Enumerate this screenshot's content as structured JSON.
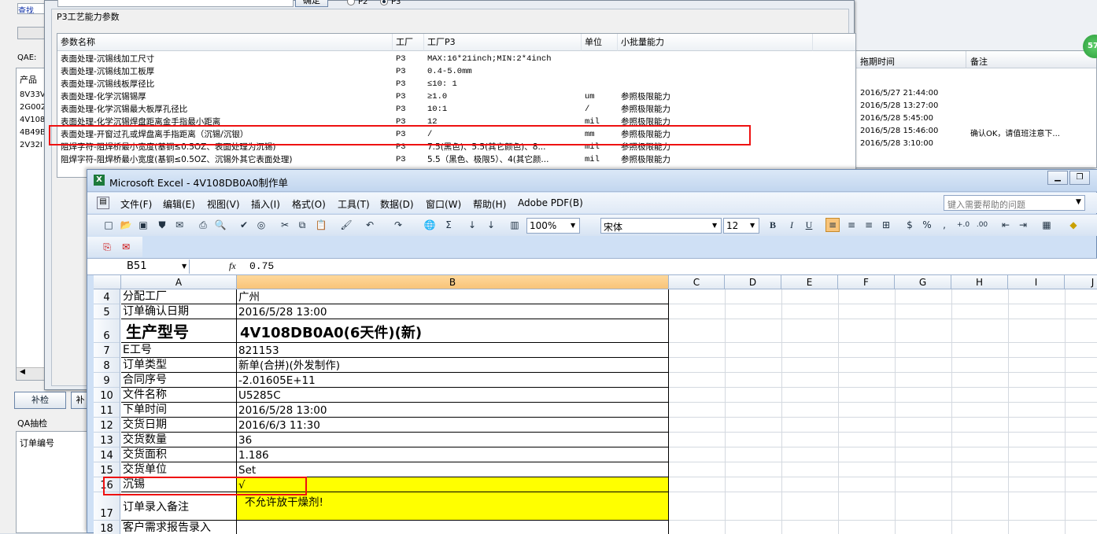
{
  "background": {
    "left_top_text": "查找",
    "qae_label": "QAE:",
    "product_col": "产品",
    "left_rows": [
      "8V33V",
      "2G002",
      "4V108",
      "4B49B",
      "2V32I"
    ],
    "btn_supplement": "补检",
    "btn_supplement2": "补",
    "qa_sample_label": "QA抽检",
    "order_no_col": "订单编号",
    "right_headers": [
      "拖期时间",
      "备注"
    ],
    "right_rows": [
      {
        "time": "2016/5/27 21:44:00",
        "note": ""
      },
      {
        "time": "2016/5/28 13:27:00",
        "note": ""
      },
      {
        "time": "2016/5/28 5:45:00",
        "note": ""
      },
      {
        "time": "2016/5/28 15:46:00",
        "note": "确认OK，请值班注意下..."
      },
      {
        "time": "2016/5/28 3:10:00",
        "note": ""
      }
    ],
    "badge": "57"
  },
  "dialog": {
    "confirm_btn": "确定",
    "radio_p2": "P2",
    "radio_p3": "P3",
    "group_title": "P3工艺能力参数",
    "columns": [
      "参数名称",
      "工厂",
      "工厂P3",
      "单位",
      "小批量能力"
    ],
    "rows": [
      [
        "表面处理-沉锡线加工尺寸",
        "P3",
        "MAX:16*21inch;MIN:2*4inch",
        "",
        ""
      ],
      [
        "表面处理-沉锡线加工板厚",
        "P3",
        "0.4-5.0mm",
        "",
        ""
      ],
      [
        "表面处理-沉锡线板厚径比",
        "P3",
        "≤10: 1",
        "",
        ""
      ],
      [
        "表面处理-化学沉锡锡厚",
        "P3",
        "≥1.0",
        "um",
        "参照极限能力"
      ],
      [
        "表面处理-化学沉锡最大板厚孔径比",
        "P3",
        "10:1",
        "/",
        "参照极限能力"
      ],
      [
        "表面处理-化学沉锡焊盘距离金手指最小距离",
        "P3",
        "12",
        "mil",
        "参照极限能力"
      ],
      [
        "表面处理-开窗过孔或焊盘离手指距离（沉锡/沉银）",
        "P3",
        "/",
        "mm",
        "参照极限能力"
      ],
      [
        "阻焊字符-阻焊桥最小宽度(基铜≤0.5OZ、表面处理为沉锡)",
        "P3",
        "7.5(黑色)、5.5(其它颜色)、8...",
        "mil",
        "参照极限能力"
      ],
      [
        "阻焊字符-阻焊桥最小宽度(基铜≤0.5OZ、沉锡外其它表面处理)",
        "P3",
        "5.5（黑色、极限5）、4(其它颜...",
        "mil",
        "参照极限能力"
      ]
    ]
  },
  "excel": {
    "title": "Microsoft Excel - 4V108DB0A0制作单",
    "menu": [
      "文件(F)",
      "编辑(E)",
      "视图(V)",
      "插入(I)",
      "格式(O)",
      "工具(T)",
      "数据(D)",
      "窗口(W)",
      "帮助(H)",
      "Adobe PDF(B)"
    ],
    "help_placeholder": "键入需要帮助的问题",
    "zoom": "100%",
    "font_name": "宋体",
    "font_size": "12",
    "name_box": "B51",
    "fx": "fx",
    "formula": "0.75",
    "columns": [
      "A",
      "B",
      "C",
      "D",
      "E",
      "F",
      "G",
      "H",
      "I",
      "J"
    ],
    "rows": [
      {
        "num": "4",
        "a": "分配工厂",
        "b": "广州"
      },
      {
        "num": "5",
        "a": "订单确认日期",
        "b": "2016/5/28 13:00"
      },
      {
        "num": "6",
        "a": "生产型号",
        "b": "4V108DB0A0(6天件)(新)"
      },
      {
        "num": "7",
        "a": "E工号",
        "b": "821153"
      },
      {
        "num": "8",
        "a": "订单类型",
        "b": "新单(合拼)(外发制作)"
      },
      {
        "num": "9",
        "a": "合同序号",
        "b": "-2.01605E+11"
      },
      {
        "num": "10",
        "a": "文件名称",
        "b": "U5285C"
      },
      {
        "num": "11",
        "a": "下单时间",
        "b": "2016/5/28 13:00"
      },
      {
        "num": "12",
        "a": "交货日期",
        "b": "2016/6/3 11:30"
      },
      {
        "num": "13",
        "a": "交货数量",
        "b": "36"
      },
      {
        "num": "14",
        "a": "交货面积",
        "b": "1.186"
      },
      {
        "num": "15",
        "a": "交货单位",
        "b": "Set"
      },
      {
        "num": "16",
        "a": "沉锡",
        "b": "√"
      },
      {
        "num": "17",
        "a": "订单录入备注",
        "b": "不允许放干燥剂!"
      },
      {
        "num": "18",
        "a": "客户需求报告录入",
        "b": ""
      }
    ]
  },
  "colors": {
    "highlight": "#ffff00",
    "annotation": "#e11111",
    "select_col": "#f8c47a"
  }
}
